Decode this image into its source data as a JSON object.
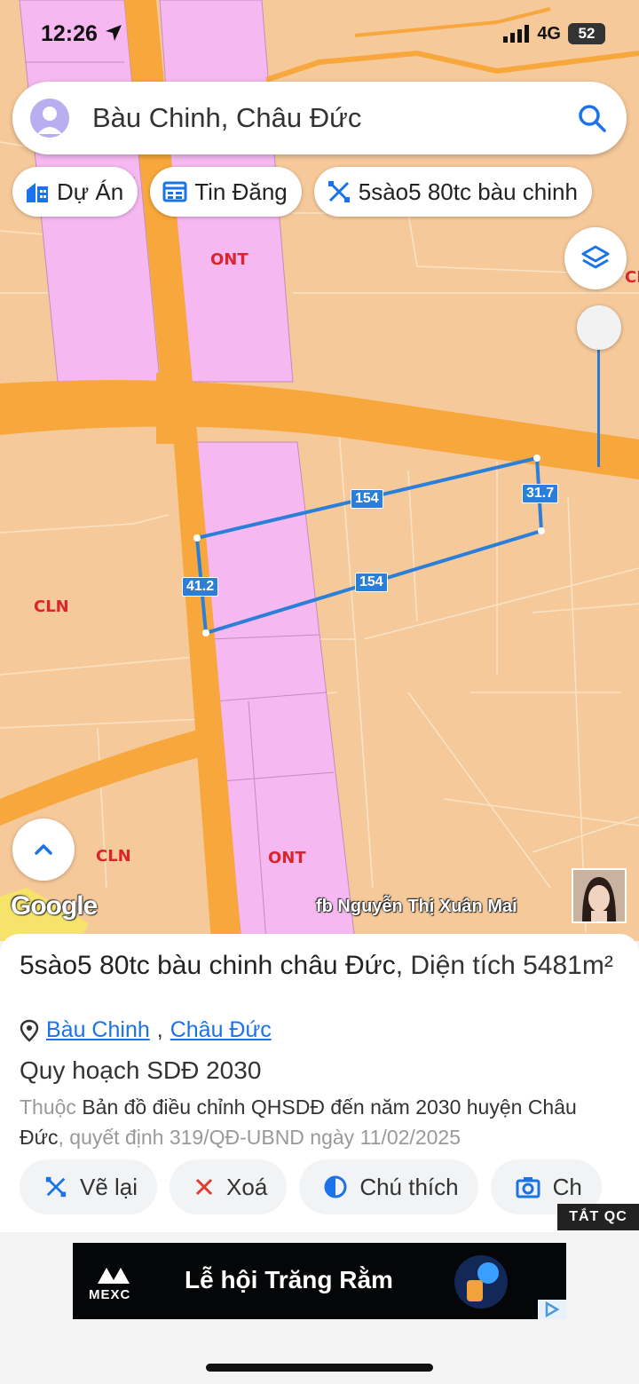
{
  "status_bar": {
    "time": "12:26",
    "network": "4G",
    "battery": "52"
  },
  "search": {
    "text": "Bàu Chinh, Châu Đức"
  },
  "chips": [
    {
      "label": "Dự Án",
      "icon": "building-icon"
    },
    {
      "label": "Tin Đăng",
      "icon": "listing-icon"
    },
    {
      "label": "5sào5 80tc bàu chinh",
      "icon": "ruler-icon"
    }
  ],
  "map": {
    "zone_labels": [
      "ONT",
      "CLN",
      "CLN",
      "ONT",
      "CL"
    ],
    "dimensions": [
      "154",
      "31.7",
      "41.2",
      "154"
    ],
    "google_logo": "Google",
    "watermark": "fb Nguyễn Thị Xuân Mai",
    "colors": {
      "residential": "#f5b8f0",
      "agri": "#f6c99a",
      "road": "#f7a73b",
      "measure": "#2c7fd8"
    }
  },
  "panel": {
    "title_bold": "5sào5 80tc bàu chinh châu Đức",
    "title_rest": ", Diện tích 5481m²",
    "location": [
      "Bàu Chinh",
      "Châu Đức"
    ],
    "location_sep": ",",
    "plan_title": "Quy hoạch SDĐ 2030",
    "plan_desc_prefix": "Thuộc",
    "plan_desc_main": "Bản đồ điều chỉnh QHSDĐ đến năm 2030 huyện Châu Đức",
    "plan_desc_suffix": ", quyết định 319/QĐ-UBND ngày 11/02/2025",
    "actions": [
      {
        "label": "Vẽ lại",
        "icon": "redraw-icon"
      },
      {
        "label": "Xoá",
        "icon": "close-icon"
      },
      {
        "label": "Chú thích",
        "icon": "legend-icon"
      },
      {
        "label": "Ch",
        "icon": "camera-icon"
      }
    ],
    "ad_close": "TẮT QC"
  },
  "ad": {
    "brand": "MEXC",
    "text": "Lễ hội Trăng Rằm"
  }
}
